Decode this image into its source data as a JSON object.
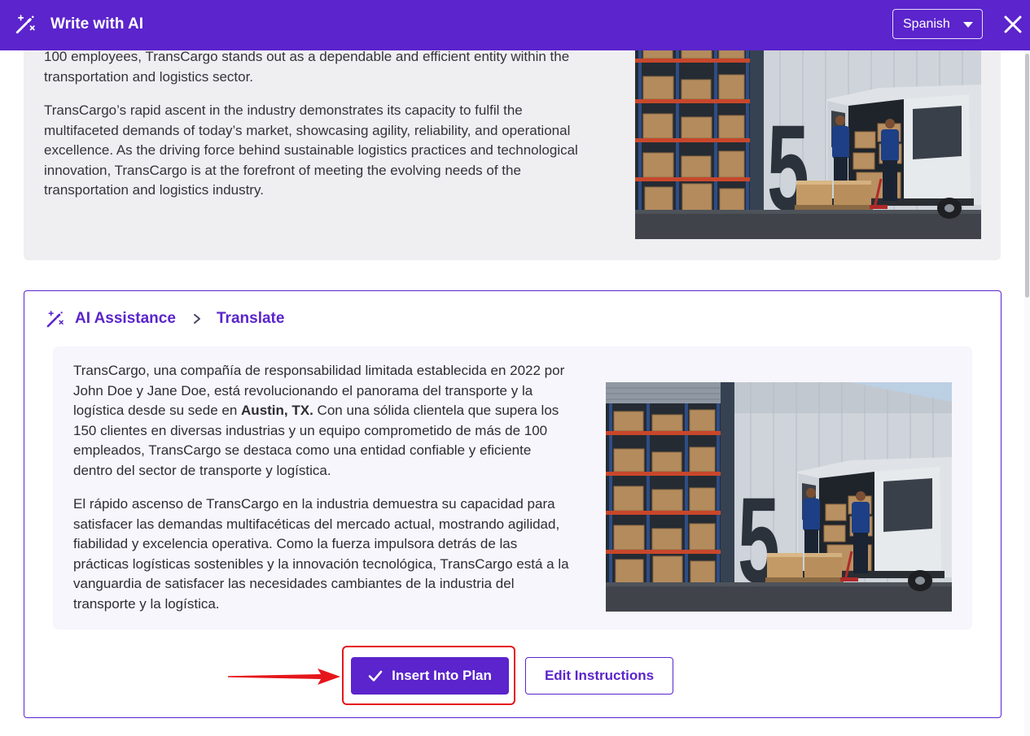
{
  "header": {
    "title": "Write with AI",
    "title_icon": "magic-wand-icon",
    "language_select": {
      "value": "Spanish",
      "icon": "caret-down-icon"
    },
    "close_icon": "close-icon"
  },
  "source_card": {
    "paragraphs": [
      [
        "100 employees, TransCargo stands out as a dependable and efficient entity within the",
        "transportation and logistics sector."
      ],
      [
        "TransCargo’s rapid ascent in the industry demonstrates its capacity to fulfil the",
        "multifaceted demands of today’s market, showcasing agility, reliability, and operational",
        "excellence. As the driving force behind sustainable logistics practices and technological",
        "innovation, TransCargo is at the forefront of meeting the evolving needs of the",
        "transportation and logistics industry."
      ]
    ]
  },
  "assistance": {
    "icon": "magic-wand-icon",
    "breadcrumb": {
      "parent": "AI Assistance",
      "separator_icon": "chevron-right-icon",
      "current": "Translate"
    },
    "paragraphs": [
      [
        "TransCargo, una compañía de responsabilidad limitada establecida en 2022 por",
        "John Doe y Jane Doe, está revolucionando el panorama del transporte y la",
        [
          "logística desde su sede en ",
          "Austin, TX.",
          " Con una sólida clientela que supera los"
        ],
        "150 clientes en diversas industrias y un equipo comprometido de más de 100",
        "empleados, TransCargo se destaca como una entidad confiable y eficiente",
        "dentro del sector de transporte y logística."
      ],
      [
        "El rápido ascenso de TransCargo en la industria demuestra su capacidad para",
        "satisfacer las demandas multifacéticas del mercado actual, mostrando agilidad,",
        "fiabilidad y excelencia operativa. Como la fuerza impulsora detrás de las",
        "prácticas logísticas sostenibles y la innovación tecnológica, TransCargo está a la",
        "vanguardia de satisfacer las necesidades cambiantes de la industria del",
        "transporte y la logística."
      ]
    ],
    "actions": {
      "insert_label": "Insert Into Plan",
      "insert_icon": "checkmark-icon",
      "edit_label": "Edit Instructions"
    }
  },
  "photo": {
    "wall_number": "5"
  },
  "annotation": {
    "highlight_color": "#e5161b",
    "arrow_color": "#e5161b"
  },
  "colors": {
    "brand": "#5b24cc",
    "surface_gray": "#efeff2",
    "surface_lavender": "#f7f6fd",
    "text": "#2f2f35"
  }
}
